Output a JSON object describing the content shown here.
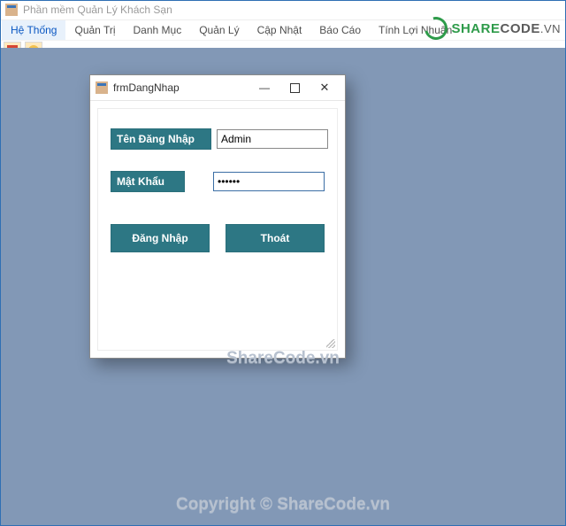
{
  "main_window": {
    "title": "Phần mềm Quản Lý Khách Sạn"
  },
  "menu": {
    "items": [
      {
        "label": "Hệ Thống",
        "selected": true
      },
      {
        "label": "Quản Trị"
      },
      {
        "label": "Danh Mục"
      },
      {
        "label": "Quản Lý"
      },
      {
        "label": "Cập Nhật"
      },
      {
        "label": "Báo Cáo"
      },
      {
        "label": "Tính Lợi Nhuận"
      }
    ]
  },
  "toolbar": {
    "buttons": [
      {
        "name": "power-icon"
      },
      {
        "name": "refresh-icon"
      }
    ]
  },
  "logo": {
    "share": "SHARE",
    "code": "CODE",
    "vn": ".VN"
  },
  "login_dialog": {
    "title": "frmDangNhap",
    "username_label": "Tên Đăng Nhập",
    "username_value": "Admin",
    "password_label": "Mật Khẩu",
    "password_value": "••••••",
    "login_btn": "Đăng Nhập",
    "exit_btn": "Thoát"
  },
  "watermarks": {
    "center": "ShareCode.vn",
    "bottom": "Copyright © ShareCode.vn"
  }
}
